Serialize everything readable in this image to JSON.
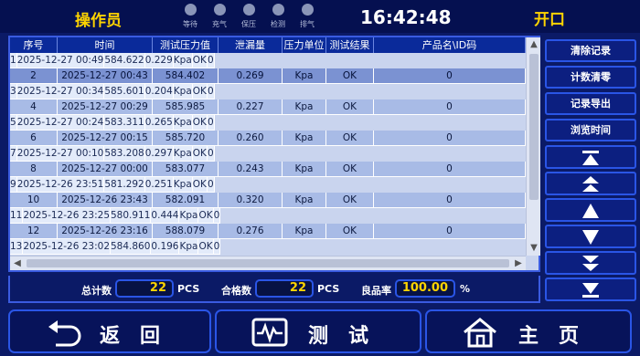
{
  "header": {
    "operator": "操作员",
    "clock": "16:42:48",
    "mode": "开口",
    "indicators": [
      {
        "label": "等待"
      },
      {
        "label": "充气"
      },
      {
        "label": "保压"
      },
      {
        "label": "检测"
      },
      {
        "label": "排气"
      }
    ]
  },
  "table": {
    "columns": [
      "序号",
      "时间",
      "测试压力值",
      "泄漏量",
      "压力单位",
      "测试结果",
      "产品名\\ID码"
    ],
    "rows": [
      {
        "no": "1",
        "time": "2025-12-27 00:49",
        "pressure": "584.622",
        "leak": "0.229",
        "unit": "Kpa",
        "result": "OK",
        "id": "0"
      },
      {
        "no": "2",
        "time": "2025-12-27 00:43",
        "pressure": "584.402",
        "leak": "0.269",
        "unit": "Kpa",
        "result": "OK",
        "id": "0"
      },
      {
        "no": "3",
        "time": "2025-12-27 00:34",
        "pressure": "585.601",
        "leak": "0.204",
        "unit": "Kpa",
        "result": "OK",
        "id": "0"
      },
      {
        "no": "4",
        "time": "2025-12-27 00:29",
        "pressure": "585.985",
        "leak": "0.227",
        "unit": "Kpa",
        "result": "OK",
        "id": "0"
      },
      {
        "no": "5",
        "time": "2025-12-27 00:24",
        "pressure": "583.311",
        "leak": "0.265",
        "unit": "Kpa",
        "result": "OK",
        "id": "0"
      },
      {
        "no": "6",
        "time": "2025-12-27 00:15",
        "pressure": "585.720",
        "leak": "0.260",
        "unit": "Kpa",
        "result": "OK",
        "id": "0"
      },
      {
        "no": "7",
        "time": "2025-12-27 00:10",
        "pressure": "583.208",
        "leak": "0.297",
        "unit": "Kpa",
        "result": "OK",
        "id": "0"
      },
      {
        "no": "8",
        "time": "2025-12-27 00:00",
        "pressure": "583.077",
        "leak": "0.243",
        "unit": "Kpa",
        "result": "OK",
        "id": "0"
      },
      {
        "no": "9",
        "time": "2025-12-26 23:51",
        "pressure": "581.292",
        "leak": "0.251",
        "unit": "Kpa",
        "result": "OK",
        "id": "0"
      },
      {
        "no": "10",
        "time": "2025-12-26 23:43",
        "pressure": "582.091",
        "leak": "0.320",
        "unit": "Kpa",
        "result": "OK",
        "id": "0"
      },
      {
        "no": "11",
        "time": "2025-12-26 23:25",
        "pressure": "580.911",
        "leak": "0.444",
        "unit": "Kpa",
        "result": "OK",
        "id": "0"
      },
      {
        "no": "12",
        "time": "2025-12-26 23:16",
        "pressure": "588.079",
        "leak": "0.276",
        "unit": "Kpa",
        "result": "OK",
        "id": "0"
      },
      {
        "no": "13",
        "time": "2025-12-26 23:02",
        "pressure": "584.860",
        "leak": "0.196",
        "unit": "Kpa",
        "result": "OK",
        "id": "0"
      }
    ]
  },
  "stats": {
    "total_label": "总计数",
    "total_value": "22",
    "total_unit": "PCS",
    "pass_label": "合格数",
    "pass_value": "22",
    "pass_unit": "PCS",
    "rate_label": "良品率",
    "rate_value": "100.00",
    "rate_unit": "%"
  },
  "side_buttons": {
    "clear_records": "清除记录",
    "reset_count": "计数清零",
    "export_records": "记录导出",
    "browse_time": "浏览时间",
    "arrows": [
      "to-top-icon",
      "page-up-icon",
      "up-icon",
      "down-icon",
      "page-down-icon",
      "to-bottom-icon"
    ]
  },
  "nav": {
    "back": "返回",
    "test": "测试",
    "home": "主页"
  },
  "colors": {
    "background": "#0b1a66",
    "accent_yellow": "#ffd400",
    "border_blue": "#2a55e6",
    "header_blue": "#0a2a9a"
  }
}
